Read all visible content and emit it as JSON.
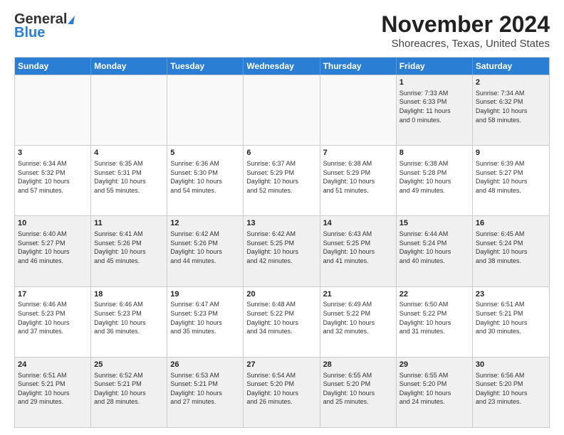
{
  "header": {
    "logo_general": "General",
    "logo_blue": "Blue",
    "month_title": "November 2024",
    "subtitle": "Shoreacres, Texas, United States"
  },
  "weekdays": [
    "Sunday",
    "Monday",
    "Tuesday",
    "Wednesday",
    "Thursday",
    "Friday",
    "Saturday"
  ],
  "weeks": [
    [
      {
        "day": "",
        "info": "",
        "empty": true
      },
      {
        "day": "",
        "info": "",
        "empty": true
      },
      {
        "day": "",
        "info": "",
        "empty": true
      },
      {
        "day": "",
        "info": "",
        "empty": true
      },
      {
        "day": "",
        "info": "",
        "empty": true
      },
      {
        "day": "1",
        "info": "Sunrise: 7:33 AM\nSunset: 6:33 PM\nDaylight: 11 hours\nand 0 minutes.",
        "empty": false
      },
      {
        "day": "2",
        "info": "Sunrise: 7:34 AM\nSunset: 6:32 PM\nDaylight: 10 hours\nand 58 minutes.",
        "empty": false
      }
    ],
    [
      {
        "day": "3",
        "info": "Sunrise: 6:34 AM\nSunset: 5:32 PM\nDaylight: 10 hours\nand 57 minutes.",
        "empty": false
      },
      {
        "day": "4",
        "info": "Sunrise: 6:35 AM\nSunset: 5:31 PM\nDaylight: 10 hours\nand 55 minutes.",
        "empty": false
      },
      {
        "day": "5",
        "info": "Sunrise: 6:36 AM\nSunset: 5:30 PM\nDaylight: 10 hours\nand 54 minutes.",
        "empty": false
      },
      {
        "day": "6",
        "info": "Sunrise: 6:37 AM\nSunset: 5:29 PM\nDaylight: 10 hours\nand 52 minutes.",
        "empty": false
      },
      {
        "day": "7",
        "info": "Sunrise: 6:38 AM\nSunset: 5:29 PM\nDaylight: 10 hours\nand 51 minutes.",
        "empty": false
      },
      {
        "day": "8",
        "info": "Sunrise: 6:38 AM\nSunset: 5:28 PM\nDaylight: 10 hours\nand 49 minutes.",
        "empty": false
      },
      {
        "day": "9",
        "info": "Sunrise: 6:39 AM\nSunset: 5:27 PM\nDaylight: 10 hours\nand 48 minutes.",
        "empty": false
      }
    ],
    [
      {
        "day": "10",
        "info": "Sunrise: 6:40 AM\nSunset: 5:27 PM\nDaylight: 10 hours\nand 46 minutes.",
        "empty": false
      },
      {
        "day": "11",
        "info": "Sunrise: 6:41 AM\nSunset: 5:26 PM\nDaylight: 10 hours\nand 45 minutes.",
        "empty": false
      },
      {
        "day": "12",
        "info": "Sunrise: 6:42 AM\nSunset: 5:26 PM\nDaylight: 10 hours\nand 44 minutes.",
        "empty": false
      },
      {
        "day": "13",
        "info": "Sunrise: 6:42 AM\nSunset: 5:25 PM\nDaylight: 10 hours\nand 42 minutes.",
        "empty": false
      },
      {
        "day": "14",
        "info": "Sunrise: 6:43 AM\nSunset: 5:25 PM\nDaylight: 10 hours\nand 41 minutes.",
        "empty": false
      },
      {
        "day": "15",
        "info": "Sunrise: 6:44 AM\nSunset: 5:24 PM\nDaylight: 10 hours\nand 40 minutes.",
        "empty": false
      },
      {
        "day": "16",
        "info": "Sunrise: 6:45 AM\nSunset: 5:24 PM\nDaylight: 10 hours\nand 38 minutes.",
        "empty": false
      }
    ],
    [
      {
        "day": "17",
        "info": "Sunrise: 6:46 AM\nSunset: 5:23 PM\nDaylight: 10 hours\nand 37 minutes.",
        "empty": false
      },
      {
        "day": "18",
        "info": "Sunrise: 6:46 AM\nSunset: 5:23 PM\nDaylight: 10 hours\nand 36 minutes.",
        "empty": false
      },
      {
        "day": "19",
        "info": "Sunrise: 6:47 AM\nSunset: 5:23 PM\nDaylight: 10 hours\nand 35 minutes.",
        "empty": false
      },
      {
        "day": "20",
        "info": "Sunrise: 6:48 AM\nSunset: 5:22 PM\nDaylight: 10 hours\nand 34 minutes.",
        "empty": false
      },
      {
        "day": "21",
        "info": "Sunrise: 6:49 AM\nSunset: 5:22 PM\nDaylight: 10 hours\nand 32 minutes.",
        "empty": false
      },
      {
        "day": "22",
        "info": "Sunrise: 6:50 AM\nSunset: 5:22 PM\nDaylight: 10 hours\nand 31 minutes.",
        "empty": false
      },
      {
        "day": "23",
        "info": "Sunrise: 6:51 AM\nSunset: 5:21 PM\nDaylight: 10 hours\nand 30 minutes.",
        "empty": false
      }
    ],
    [
      {
        "day": "24",
        "info": "Sunrise: 6:51 AM\nSunset: 5:21 PM\nDaylight: 10 hours\nand 29 minutes.",
        "empty": false
      },
      {
        "day": "25",
        "info": "Sunrise: 6:52 AM\nSunset: 5:21 PM\nDaylight: 10 hours\nand 28 minutes.",
        "empty": false
      },
      {
        "day": "26",
        "info": "Sunrise: 6:53 AM\nSunset: 5:21 PM\nDaylight: 10 hours\nand 27 minutes.",
        "empty": false
      },
      {
        "day": "27",
        "info": "Sunrise: 6:54 AM\nSunset: 5:20 PM\nDaylight: 10 hours\nand 26 minutes.",
        "empty": false
      },
      {
        "day": "28",
        "info": "Sunrise: 6:55 AM\nSunset: 5:20 PM\nDaylight: 10 hours\nand 25 minutes.",
        "empty": false
      },
      {
        "day": "29",
        "info": "Sunrise: 6:55 AM\nSunset: 5:20 PM\nDaylight: 10 hours\nand 24 minutes.",
        "empty": false
      },
      {
        "day": "30",
        "info": "Sunrise: 6:56 AM\nSunset: 5:20 PM\nDaylight: 10 hours\nand 23 minutes.",
        "empty": false
      }
    ]
  ]
}
